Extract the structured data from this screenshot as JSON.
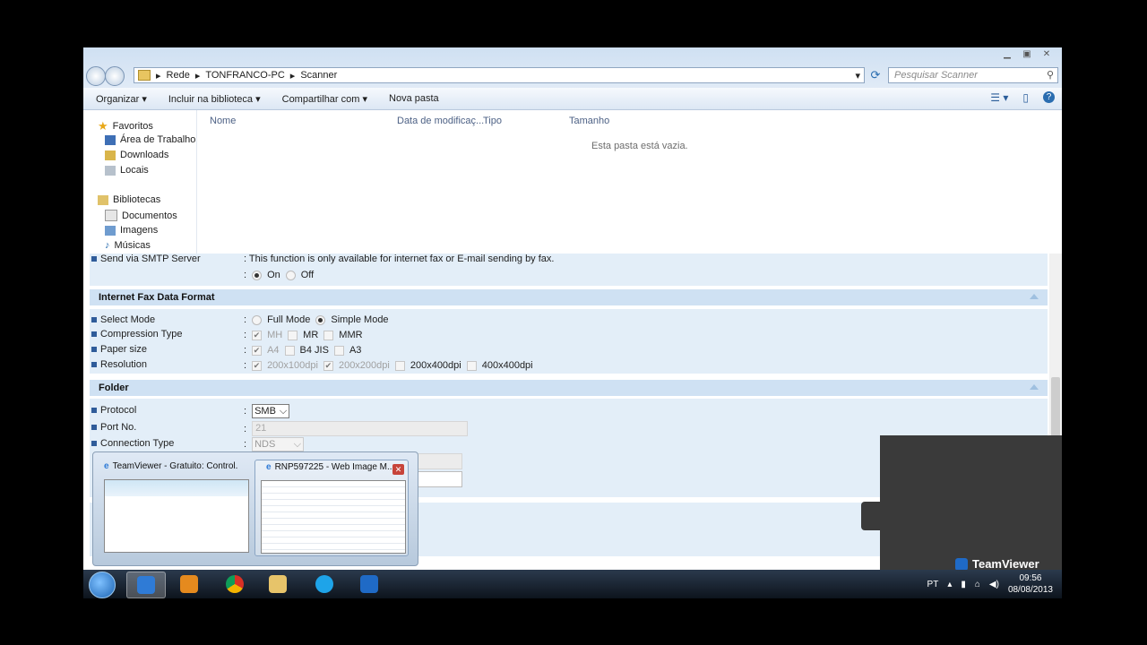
{
  "explorer": {
    "breadcrumb": [
      "Rede",
      "TONFRANCO-PC",
      "Scanner"
    ],
    "search_placeholder": "Pesquisar Scanner",
    "toolbar": {
      "organize": "Organizar ▾",
      "include": "Incluir na biblioteca ▾",
      "share": "Compartilhar com ▾",
      "new_folder": "Nova pasta"
    },
    "nav": {
      "favorites": "Favoritos",
      "desktop": "Área de Trabalho",
      "downloads": "Downloads",
      "locais": "Locais",
      "libraries": "Bibliotecas",
      "documents": "Documentos",
      "images": "Imagens",
      "music": "Músicas"
    },
    "columns": {
      "name": "Nome",
      "date": "Data de modificaç...",
      "type": "Tipo",
      "size": "Tamanho"
    },
    "empty_text": "Esta pasta está vazia."
  },
  "form": {
    "smtp": {
      "label": "Send via SMTP Server",
      "note": ": This function is only available for internet fax or E-mail sending by fax.",
      "on": "On",
      "off": "Off"
    },
    "internet_fax": {
      "title": "Internet Fax Data Format",
      "select_mode": "Select Mode",
      "full_mode": "Full Mode",
      "simple_mode": "Simple Mode",
      "compression": "Compression Type",
      "mh": "MH",
      "mr": "MR",
      "mmr": "MMR",
      "paper": "Paper size",
      "a4": "A4",
      "b4": "B4 JIS",
      "a3": "A3",
      "resolution": "Resolution",
      "r1": "200x100dpi",
      "r2": "200x200dpi",
      "r3": "200x400dpi",
      "r4": "400x400dpi"
    },
    "folder": {
      "title": "Folder",
      "protocol": "Protocol",
      "protocol_val": "SMB",
      "port": "Port No.",
      "port_val": "21",
      "conn": "Connection Type",
      "conn_val": "NDS"
    }
  },
  "thumbs": {
    "t1": "TeamViewer - Gratuito: Control...",
    "t2": "RNP597225 - Web Image M..."
  },
  "teamviewer_label": "TeamViewer",
  "tray": {
    "lang": "PT",
    "time": "09:56",
    "date": "08/08/2013"
  }
}
